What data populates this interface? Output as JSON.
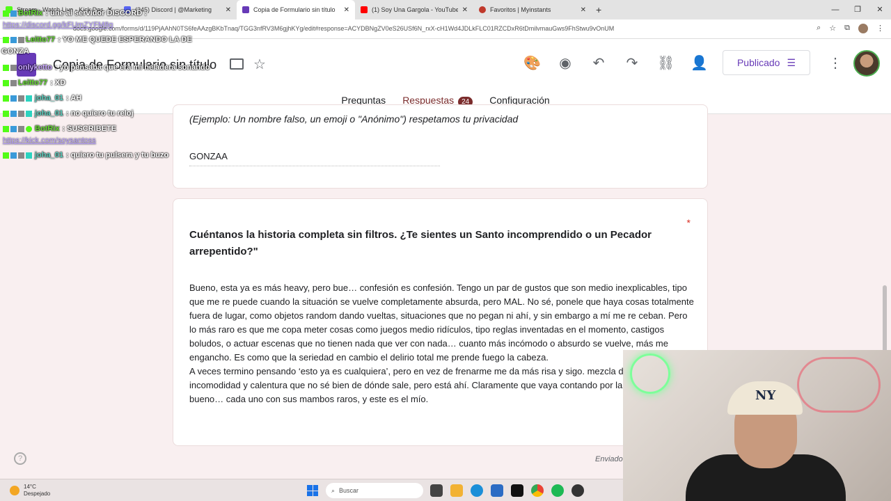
{
  "browser": {
    "tabs": [
      {
        "label": "Stream - Watch Live - Kick Dashboard",
        "color": "#53fc18",
        "active": false
      },
      {
        "label": "(245) Discord | @Marketing",
        "color": "#5865f2",
        "active": false
      },
      {
        "label": "Copia de Formulario sin título",
        "color": "#673ab7",
        "active": true
      },
      {
        "label": "(1) Soy Una Gargola - YouTube",
        "color": "#ff0000",
        "active": false
      },
      {
        "label": "Favoritos | Myinstants",
        "color": "#c0392b",
        "active": false
      }
    ],
    "url": "docs.google.com/forms/d/119PjAAhN0TS6feAAzgBKbTnaq/TGG3nfRV3M6gjhKYg/edit#response=ACYDBNgZV0eS26USf6N_rxX-cH1Wd4JDLkFLC01RZCDxR6tDmilvmauGws9FhStwu9vOnUM"
  },
  "form": {
    "title": "Copia de Formulario sin título",
    "publish_label": "Publicado",
    "tabs": {
      "questions": "Preguntas",
      "responses": "Respuestas",
      "responses_count": "24",
      "settings": "Configuración"
    },
    "card1": {
      "hint": "(Ejemplo: Un nombre falso, un emoji o \"Anónimo\") respetamos tu privacidad",
      "answer": "GONZAA"
    },
    "card2": {
      "required_mark": "*",
      "question": "Cuéntanos la historia completa sin filtros. ¿Te sientes un Santo incomprendido o un Pecador arrepentido?\"",
      "answer_p1": "Bueno, esta ya es más heavy, pero bue… confesión es confesión. Tengo un par de gustos que son medio inexplicables, tipo que me re puede cuando la situación se vuelve completamente absurda, pero MAL. No sé, ponele que haya cosas totalmente fuera de lugar, como objetos random dando vueltas, situaciones que no pegan ni ahí, y sin embargo a mí me re ceban. Pero lo más raro es que me copa meter cosas como juegos medio ridículos, tipo reglas inventadas en el momento, castigos boludos, o actuar escenas que no tienen nada que ver con nada… cuanto más incómodo o absurdo se vuelve, más me engancho. Es como que la seriedad en cambio el delirio total me prende fuego la cabeza.",
      "answer_p2": "A veces termino pensando ‘esto ya es cualquiera’, pero en vez de frenarme me da más risa y sigo. mezcla de humor, incomodidad y calentura que no sé bien de dónde sale, pero está ahí. Claramente que vaya contando por la vida, pero bueno… cada uno con sus mambos raros, y este es el mío."
    },
    "sent_label": "Enviado"
  },
  "chat": {
    "top": {
      "user": "BotRix",
      "text": ": une al servidor DISCORD :"
    },
    "link1": "https://discord.gg/kFUmZYFM8g",
    "lines": [
      {
        "user": "Leitto77",
        "text": ": YO ME QUEDE ESPERANDO LA DE"
      },
      {
        "user": "",
        "text": "GONZA"
      },
      {
        "user": "onlyketto",
        "text": ": yo pensaba que era mi heladera sonando"
      },
      {
        "user": "Leitto77",
        "text": ": XD"
      },
      {
        "user": "joha_01",
        "text": ": AH"
      },
      {
        "user": "joha_01",
        "text": ": no quiero tu reloj"
      },
      {
        "user": "BotRix",
        "text": ": SUSCRIBETE"
      },
      {
        "user": "joha_01",
        "text": ": quiero tu pulsera y tu buzo"
      }
    ],
    "link2": "https://kick.com/soysantoss"
  },
  "taskbar": {
    "temp": "14°C",
    "weather": "Despejado",
    "search_placeholder": "Buscar"
  },
  "webcam": {
    "cap_logo": "NY"
  }
}
